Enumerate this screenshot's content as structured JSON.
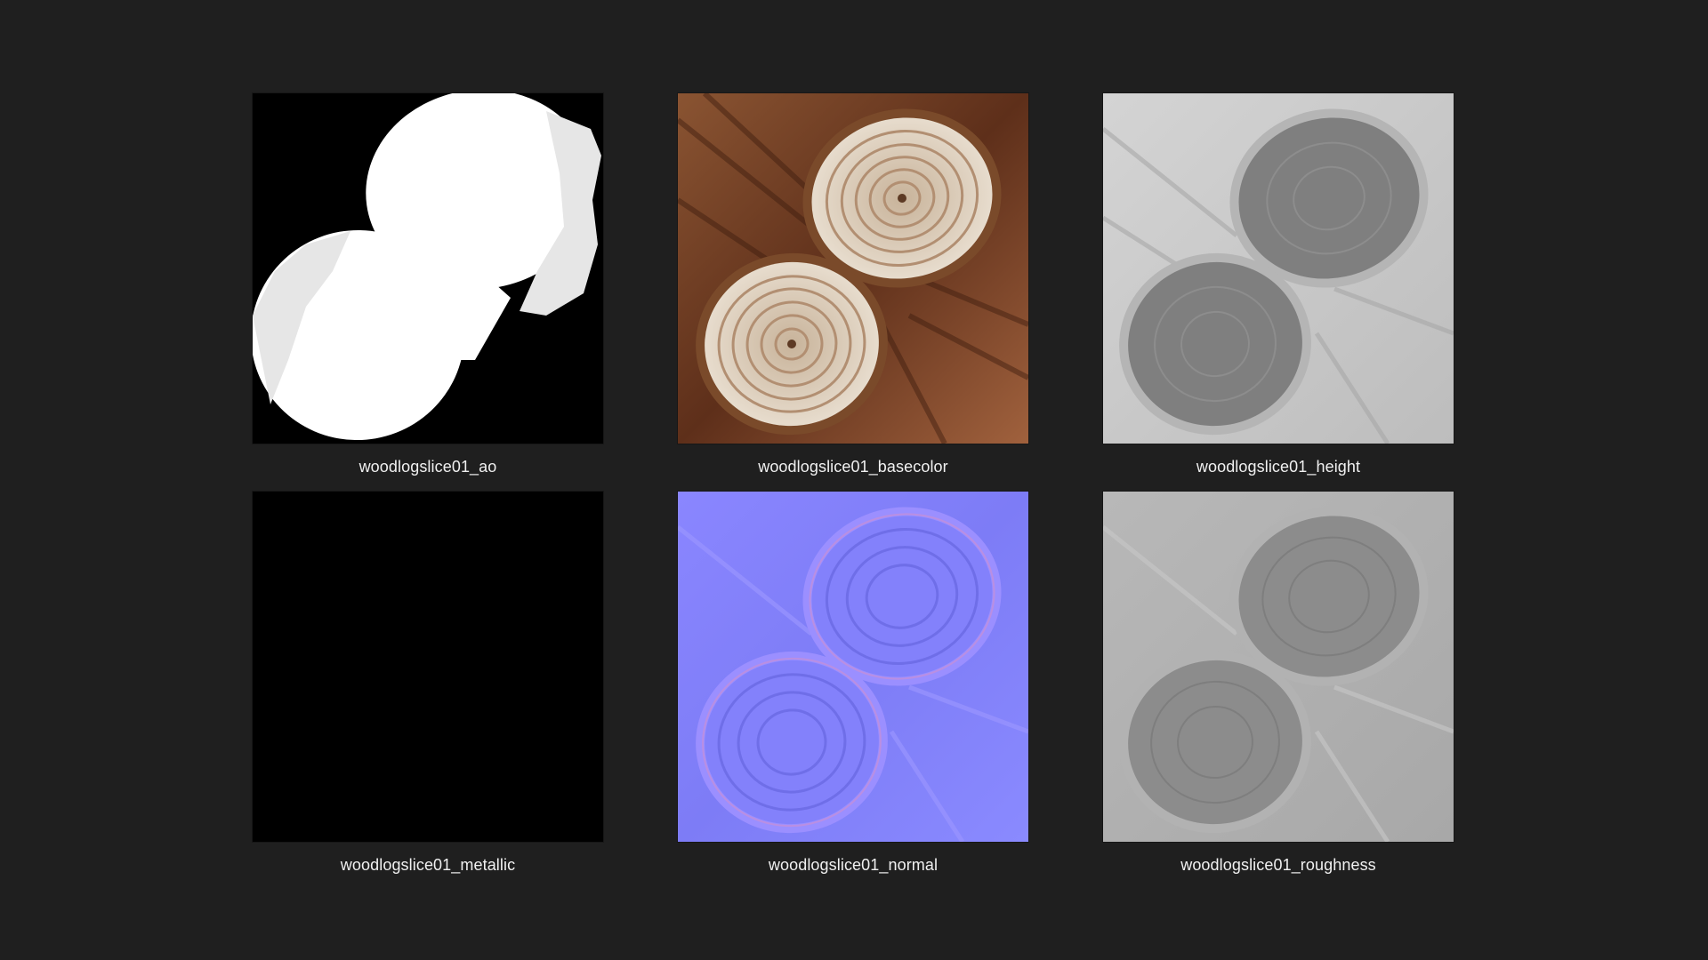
{
  "files": [
    {
      "name": "woodlogslice01_ao",
      "map": "ao"
    },
    {
      "name": "woodlogslice01_basecolor",
      "map": "basecolor"
    },
    {
      "name": "woodlogslice01_height",
      "map": "height"
    },
    {
      "name": "woodlogslice01_metallic",
      "map": "metallic"
    },
    {
      "name": "woodlogslice01_normal",
      "map": "normal"
    },
    {
      "name": "woodlogslice01_roughness",
      "map": "roughness"
    }
  ],
  "colors": {
    "background": "#1f1f1f",
    "caption_text": "#f0f0f0",
    "basecolor_bark": "#6e3a1f",
    "basecolor_wood": "#d9c9b3",
    "normal_base": "#8080ff",
    "height_base": "#8a8a8a",
    "roughness_base": "#9a9a9a"
  }
}
